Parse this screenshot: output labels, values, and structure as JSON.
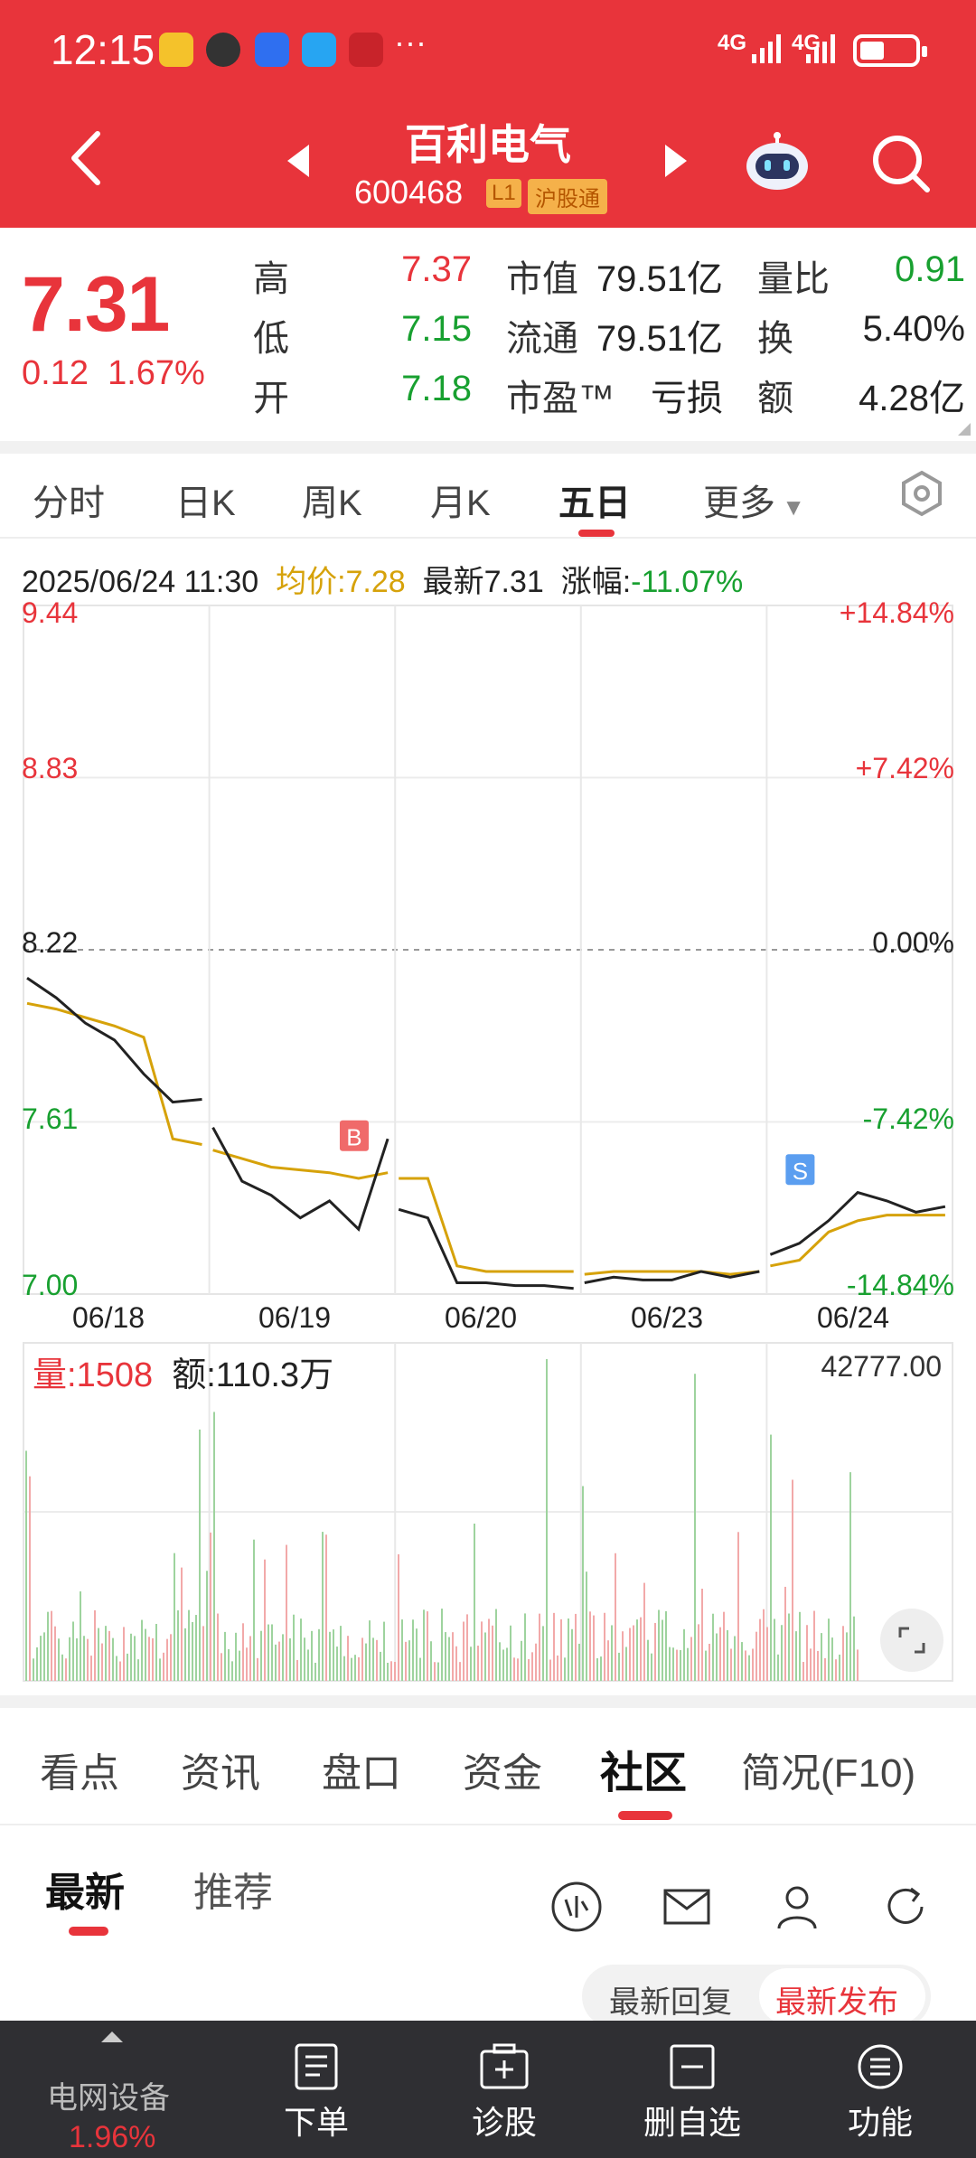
{
  "status_bar": {
    "time": "12:15",
    "network_1": "4G",
    "network_2": "4G"
  },
  "header": {
    "stock_name": "百利电气",
    "stock_code": "600468",
    "badge_level": "L1",
    "badge_market": "沪股通"
  },
  "quote": {
    "price": "7.31",
    "change": "0.12",
    "change_pct": "1.67%",
    "rows": [
      {
        "l1": "高",
        "v1": "7.37",
        "l2": "市值",
        "v2": "79.51亿",
        "l3": "量比",
        "v3": "0.91"
      },
      {
        "l1": "低",
        "v1": "7.15",
        "l2": "流通",
        "v2": "79.51亿",
        "l3": "换",
        "v3": "5.40%"
      },
      {
        "l1": "开",
        "v1": "7.18",
        "l2": "市盈™",
        "v2": "亏损",
        "l3": "额",
        "v3": "4.28亿"
      }
    ]
  },
  "period_tabs": [
    "分时",
    "日K",
    "周K",
    "月K",
    "五日",
    "更多"
  ],
  "active_period": "五日",
  "chart_info": {
    "datetime": "2025/06/24 11:30",
    "avg_label": "均价:7.28",
    "latest_label": "最新7.31",
    "change_label": "涨幅:",
    "change_value": "-11.07%"
  },
  "chart_data": {
    "type": "line",
    "title": "",
    "x": [
      "06/18",
      "06/19",
      "06/20",
      "06/23",
      "06/24"
    ],
    "y_ticks": [
      "9.44",
      "8.83",
      "8.22",
      "7.61",
      "7.00"
    ],
    "y_pct_ticks": [
      "+14.84%",
      "+7.42%",
      "0.00%",
      "-7.42%",
      "-14.84%"
    ],
    "ylim": [
      7.0,
      9.44
    ],
    "prev_close": 8.22,
    "series": [
      {
        "name": "价格",
        "values": [
          8.12,
          8.05,
          7.96,
          7.9,
          7.78,
          7.68,
          7.69,
          7.59,
          7.4,
          7.35,
          7.27,
          7.33,
          7.23,
          7.55,
          7.3,
          7.27,
          7.04,
          7.04,
          7.03,
          7.03,
          7.02,
          7.04,
          7.06,
          7.05,
          7.05,
          7.08,
          7.06,
          7.08,
          7.14,
          7.18,
          7.26,
          7.36,
          7.33,
          7.29,
          7.31
        ]
      },
      {
        "name": "均价",
        "values": [
          8.03,
          8.01,
          7.98,
          7.95,
          7.91,
          7.55,
          7.53,
          7.51,
          7.48,
          7.45,
          7.44,
          7.43,
          7.41,
          7.43,
          7.41,
          7.41,
          7.1,
          7.08,
          7.08,
          7.08,
          7.08,
          7.07,
          7.08,
          7.08,
          7.08,
          7.08,
          7.07,
          7.08,
          7.1,
          7.12,
          7.22,
          7.26,
          7.28,
          7.28,
          7.28
        ]
      }
    ],
    "markers": [
      {
        "label": "B",
        "day": "06/19",
        "value": 7.43
      },
      {
        "label": "S",
        "day": "06/24",
        "value": 7.31
      }
    ]
  },
  "volume": {
    "label": "量:",
    "value": "1508",
    "amount_label": "额:",
    "amount": "110.3万",
    "max": "42777.00"
  },
  "info_tabs": [
    "看点",
    "资讯",
    "盘口",
    "资金",
    "社区",
    "简况(F10)"
  ],
  "active_info_tab": "社区",
  "community_tabs": [
    "最新",
    "推荐"
  ],
  "sort": {
    "reply": "最新回复",
    "publish": "最新发布"
  },
  "bottom_nav": {
    "sector": "电网设备",
    "sector_pct": "1.96%",
    "items": [
      "下单",
      "诊股",
      "删自选",
      "功能"
    ]
  },
  "colors": {
    "up": "#e8343b",
    "down": "#18a030",
    "avg_line": "#d6a20a",
    "header": "#e8343b"
  }
}
